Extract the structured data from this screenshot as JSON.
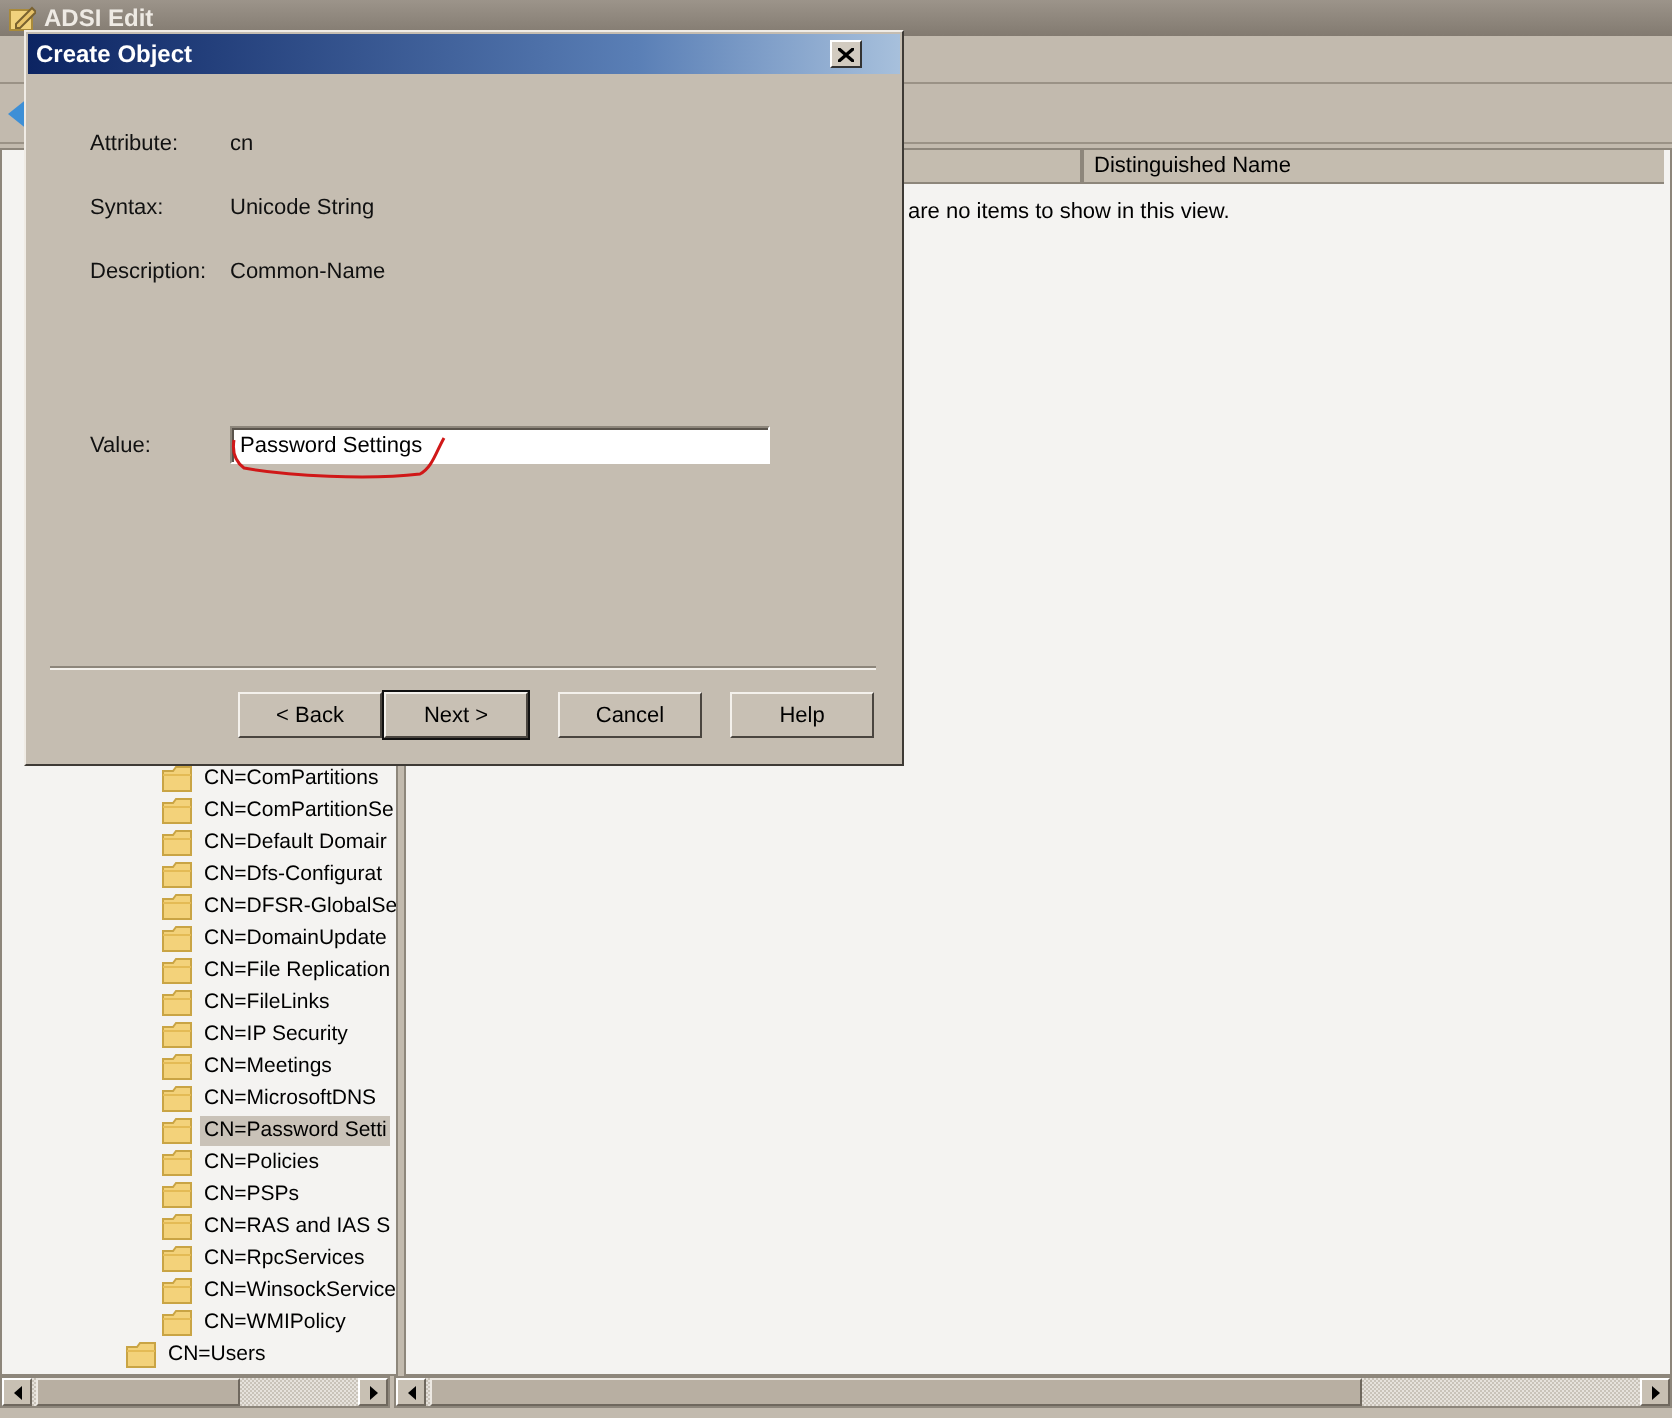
{
  "main_window": {
    "title": "ADSI Edit"
  },
  "tree": {
    "nested_items": [
      {
        "label": "CN=ComPartitions",
        "selected": false
      },
      {
        "label": "CN=ComPartitionSe",
        "selected": false
      },
      {
        "label": "CN=Default Domair",
        "selected": false
      },
      {
        "label": "CN=Dfs-Configurat",
        "selected": false
      },
      {
        "label": "CN=DFSR-GlobalSe",
        "selected": false
      },
      {
        "label": "CN=DomainUpdate",
        "selected": false
      },
      {
        "label": "CN=File Replication",
        "selected": false
      },
      {
        "label": "CN=FileLinks",
        "selected": false
      },
      {
        "label": "CN=IP Security",
        "selected": false
      },
      {
        "label": "CN=Meetings",
        "selected": false
      },
      {
        "label": "CN=MicrosoftDNS",
        "selected": false
      },
      {
        "label": "CN=Password Setti",
        "selected": true
      },
      {
        "label": "CN=Policies",
        "selected": false
      },
      {
        "label": "CN=PSPs",
        "selected": false
      },
      {
        "label": "CN=RAS and IAS S",
        "selected": false
      },
      {
        "label": "CN=RpcServices",
        "selected": false
      },
      {
        "label": "CN=WinsockService",
        "selected": false
      },
      {
        "label": "CN=WMIPolicy",
        "selected": false
      }
    ],
    "items": [
      {
        "label": "CN=Users",
        "selected": false
      }
    ]
  },
  "list": {
    "columns": [
      "Distinguished Name"
    ],
    "empty_message": "are no items to show in this view."
  },
  "dialog": {
    "title": "Create Object",
    "fields": [
      {
        "label": "Attribute:",
        "value": "cn"
      },
      {
        "label": "Syntax:",
        "value": "Unicode String"
      },
      {
        "label": "Description:",
        "value": "Common-Name"
      }
    ],
    "value_field": {
      "label": "Value:",
      "value": "Password Settings"
    },
    "buttons": [
      {
        "label": "< Back",
        "default": false
      },
      {
        "label": "Next >",
        "default": true
      },
      {
        "label": "Cancel",
        "default": false
      },
      {
        "label": "Help",
        "default": false
      }
    ]
  }
}
